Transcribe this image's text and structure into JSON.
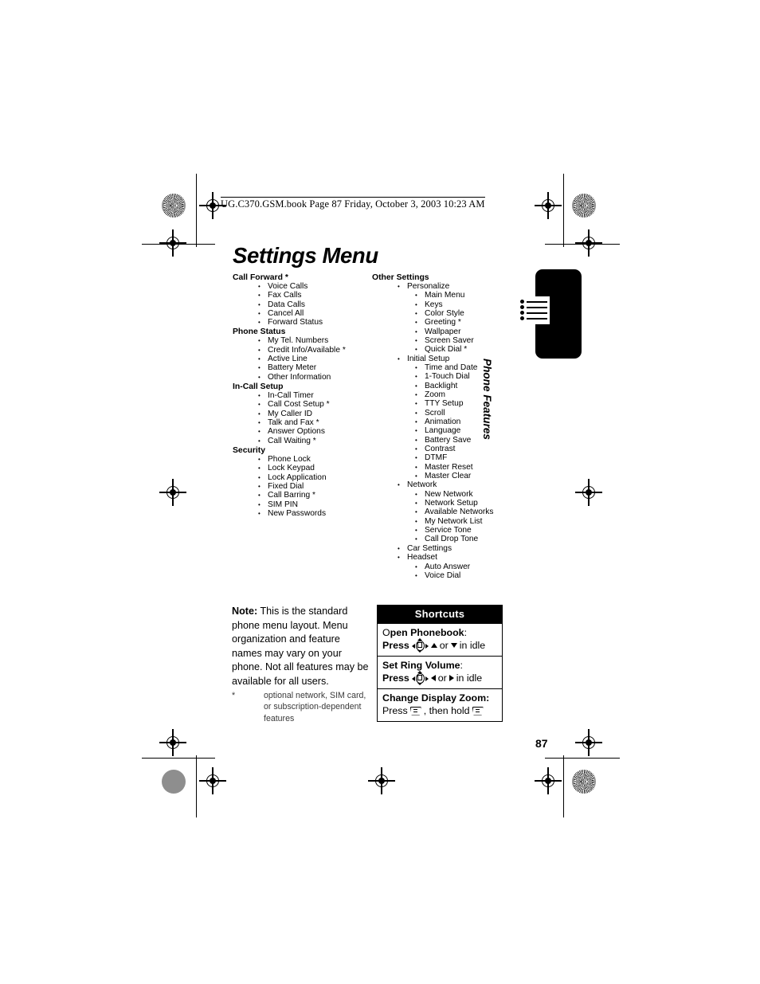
{
  "running_header": "UG.C370.GSM.book  Page 87  Friday, October 3, 2003  10:23 AM",
  "title": "Settings Menu",
  "page_number": "87",
  "side_tab": {
    "label": "Phone Features",
    "icon": "bulleted-list-icon"
  },
  "menu": {
    "left_column": [
      {
        "type": "heading",
        "label": "Call Forward *"
      },
      {
        "type": "level1",
        "label": "Voice Calls"
      },
      {
        "type": "level1",
        "label": "Fax Calls"
      },
      {
        "type": "level1",
        "label": "Data Calls"
      },
      {
        "type": "level1",
        "label": "Cancel All"
      },
      {
        "type": "level1",
        "label": "Forward Status"
      },
      {
        "type": "heading",
        "label": "Phone Status"
      },
      {
        "type": "level1",
        "label": "My Tel. Numbers"
      },
      {
        "type": "level1",
        "label": "Credit Info/Available *"
      },
      {
        "type": "level1",
        "label": "Active Line"
      },
      {
        "type": "level1",
        "label": "Battery Meter"
      },
      {
        "type": "level1",
        "label": "Other Information"
      },
      {
        "type": "heading",
        "label": "In-Call Setup"
      },
      {
        "type": "level1",
        "label": "In-Call Timer"
      },
      {
        "type": "level1",
        "label": "Call Cost Setup *"
      },
      {
        "type": "level1",
        "label": "My Caller ID"
      },
      {
        "type": "level1",
        "label": "Talk and Fax *"
      },
      {
        "type": "level1",
        "label": "Answer Options"
      },
      {
        "type": "level1",
        "label": "Call Waiting *"
      },
      {
        "type": "heading",
        "label": "Security"
      },
      {
        "type": "level1",
        "label": "Phone Lock"
      },
      {
        "type": "level1",
        "label": "Lock Keypad"
      },
      {
        "type": "level1",
        "label": "Lock Application"
      },
      {
        "type": "level1",
        "label": "Fixed Dial"
      },
      {
        "type": "level1",
        "label": "Call Barring *"
      },
      {
        "type": "level1",
        "label": "SIM PIN"
      },
      {
        "type": "level1",
        "label": "New Passwords"
      }
    ],
    "right_column": [
      {
        "type": "heading",
        "label": "Other Settings"
      },
      {
        "type": "level1",
        "label": "Personalize"
      },
      {
        "type": "level2",
        "label": "Main Menu"
      },
      {
        "type": "level2",
        "label": "Keys"
      },
      {
        "type": "level2",
        "label": "Color Style"
      },
      {
        "type": "level2",
        "label": "Greeting *"
      },
      {
        "type": "level2",
        "label": "Wallpaper"
      },
      {
        "type": "level2",
        "label": "Screen Saver"
      },
      {
        "type": "level2",
        "label": "Quick Dial *"
      },
      {
        "type": "level1",
        "label": "Initial Setup"
      },
      {
        "type": "level2",
        "label": "Time and Date"
      },
      {
        "type": "level2",
        "label": "1-Touch Dial"
      },
      {
        "type": "level2",
        "label": "Backlight"
      },
      {
        "type": "level2",
        "label": "Zoom"
      },
      {
        "type": "level2",
        "label": "TTY Setup"
      },
      {
        "type": "level2",
        "label": "Scroll"
      },
      {
        "type": "level2",
        "label": "Animation"
      },
      {
        "type": "level2",
        "label": "Language"
      },
      {
        "type": "level2",
        "label": "Battery Save"
      },
      {
        "type": "level2",
        "label": "Contrast"
      },
      {
        "type": "level2",
        "label": "DTMF"
      },
      {
        "type": "level2",
        "label": "Master Reset"
      },
      {
        "type": "level2",
        "label": "Master Clear"
      },
      {
        "type": "level1",
        "label": "Network"
      },
      {
        "type": "level2",
        "label": "New Network"
      },
      {
        "type": "level2",
        "label": "Network Setup"
      },
      {
        "type": "level2",
        "label": "Available Networks"
      },
      {
        "type": "level2",
        "label": "My Network List"
      },
      {
        "type": "level2",
        "label": "Service Tone"
      },
      {
        "type": "level2",
        "label": "Call Drop Tone"
      },
      {
        "type": "level1",
        "label": "Car Settings"
      },
      {
        "type": "level1",
        "label": "Headset"
      },
      {
        "type": "level2",
        "label": "Auto Answer"
      },
      {
        "type": "level2",
        "label": "Voice Dial"
      }
    ]
  },
  "note": {
    "label": "Note:",
    "body": " This is the standard phone menu layout. Menu organization and feature names may vary on your phone. Not all features may be available for all users."
  },
  "footnote": {
    "marker": "*",
    "text": "optional network, SIM card, or subscription-dependent features"
  },
  "shortcuts": {
    "title": "Shortcuts",
    "rows": [
      {
        "line1_prefix": "O",
        "line1_bold": "pen Phonebook",
        "line1_suffix": ":",
        "press_label": "Press",
        "key_icon": "navigation-key-icon",
        "arrow1": "up-arrow-icon",
        "conjunction": "or",
        "arrow2": "down-arrow-icon",
        "tail": "in idle"
      },
      {
        "line1_prefix": "",
        "line1_bold": "Set Ring Volume",
        "line1_suffix": ":",
        "press_label": "Press",
        "key_icon": "navigation-key-icon",
        "arrow1": "left-arrow-icon",
        "conjunction": "or",
        "arrow2": "right-arrow-icon",
        "tail": "in idle"
      }
    ],
    "zoom_row": {
      "title": "Change Display Zoom:",
      "press_label": "Press",
      "key1_icon": "soft-key-icon",
      "middle": ", then hold",
      "key2_icon": "soft-key-icon"
    }
  }
}
